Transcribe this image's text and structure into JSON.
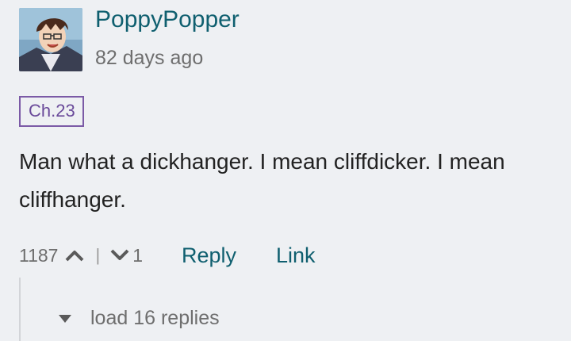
{
  "comment": {
    "username": "PoppyPopper",
    "timestamp": "82 days ago",
    "chapter_tag": "Ch.23",
    "body": "Man what a dickhanger. I mean cliffdicker. I mean cliffhanger.",
    "upvotes": "1187",
    "separator": "|",
    "downvotes": "1",
    "reply_label": "Reply",
    "link_label": "Link"
  },
  "replies": {
    "load_label": "load 16 replies"
  },
  "icons": {
    "upvote": "chevron-up-icon",
    "downvote": "chevron-down-icon",
    "expand": "caret-down-icon"
  },
  "colors": {
    "background": "#eef0f3",
    "link": "#0f5f6f",
    "muted": "#6e6e6e",
    "tag": "#7b5aa6"
  }
}
